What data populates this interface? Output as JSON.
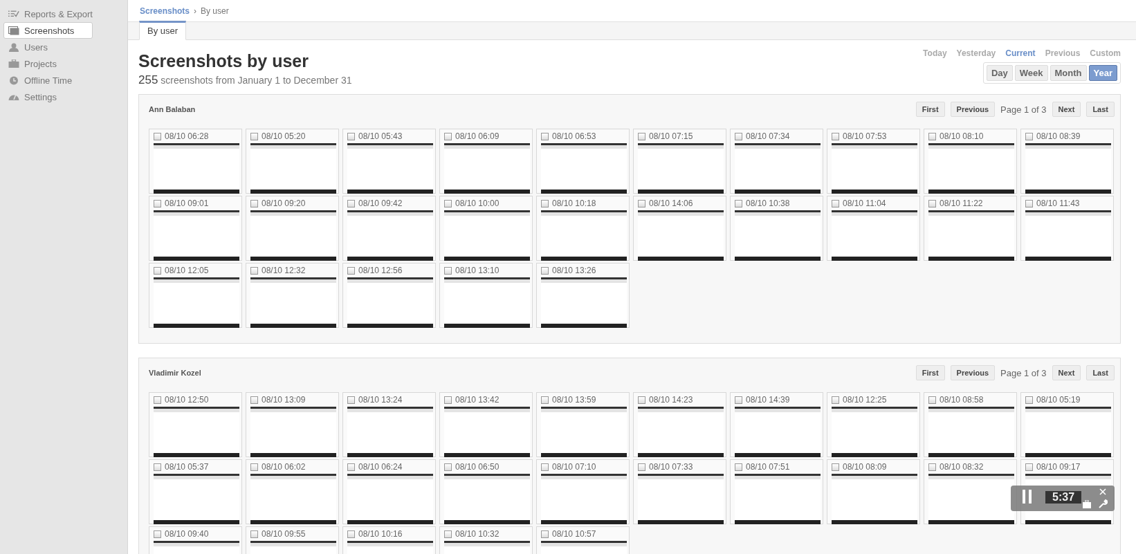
{
  "sidebar": {
    "items": [
      {
        "label": "Reports & Export",
        "selected": false
      },
      {
        "label": "Screenshots",
        "selected": true
      },
      {
        "label": "Users",
        "selected": false
      },
      {
        "label": "Projects",
        "selected": false
      },
      {
        "label": "Offline Time",
        "selected": false
      },
      {
        "label": "Settings",
        "selected": false
      }
    ]
  },
  "breadcrumb": {
    "parent": "Screenshots",
    "separator": "›",
    "current": "By user"
  },
  "tabs": [
    {
      "label": "By user",
      "selected": true
    }
  ],
  "title": "Screenshots by user",
  "summary": {
    "count": "255",
    "text": "screenshots from January 1 to December 31"
  },
  "range_links": [
    {
      "label": "Today",
      "selected": false
    },
    {
      "label": "Yesterday",
      "selected": false
    },
    {
      "label": "Current",
      "selected": true
    },
    {
      "label": "Previous",
      "selected": false
    },
    {
      "label": "Custom",
      "selected": false
    }
  ],
  "periods": [
    {
      "label": "Day",
      "selected": false
    },
    {
      "label": "Week",
      "selected": false
    },
    {
      "label": "Month",
      "selected": false
    },
    {
      "label": "Year",
      "selected": true
    }
  ],
  "users": [
    {
      "name": "Ann Balaban",
      "pager": {
        "first": "First",
        "previous": "Previous",
        "page": "Page 1 of 3",
        "next": "Next",
        "last": "Last"
      },
      "screenshots": [
        {
          "time": "08/10 06:28",
          "checked": false
        },
        {
          "time": "08/10 05:20",
          "checked": false
        },
        {
          "time": "08/10 05:43",
          "checked": false
        },
        {
          "time": "08/10 06:09",
          "checked": false
        },
        {
          "time": "08/10 06:53",
          "checked": false
        },
        {
          "time": "08/10 07:15",
          "checked": false
        },
        {
          "time": "08/10 07:34",
          "checked": false
        },
        {
          "time": "08/10 07:53",
          "checked": false
        },
        {
          "time": "08/10 08:10",
          "checked": false
        },
        {
          "time": "08/10 08:39",
          "checked": false
        },
        {
          "time": "08/10 09:01",
          "checked": false
        },
        {
          "time": "08/10 09:20",
          "checked": false
        },
        {
          "time": "08/10 09:42",
          "checked": false
        },
        {
          "time": "08/10 10:00",
          "checked": false
        },
        {
          "time": "08/10 10:18",
          "checked": false
        },
        {
          "time": "08/10 14:06",
          "checked": false
        },
        {
          "time": "08/10 10:38",
          "checked": false
        },
        {
          "time": "08/10 11:04",
          "checked": false
        },
        {
          "time": "08/10 11:22",
          "checked": false
        },
        {
          "time": "08/10 11:43",
          "checked": false
        },
        {
          "time": "08/10 12:05",
          "checked": false
        },
        {
          "time": "08/10 12:32",
          "checked": false
        },
        {
          "time": "08/10 12:56",
          "checked": false
        },
        {
          "time": "08/10 13:10",
          "checked": false
        },
        {
          "time": "08/10 13:26",
          "checked": false
        }
      ]
    },
    {
      "name": "Vladimir Kozel",
      "pager": {
        "first": "First",
        "previous": "Previous",
        "page": "Page 1 of 3",
        "next": "Next",
        "last": "Last"
      },
      "screenshots": [
        {
          "time": "08/10 12:50",
          "checked": false
        },
        {
          "time": "08/10 13:09",
          "checked": false
        },
        {
          "time": "08/10 13:24",
          "checked": false
        },
        {
          "time": "08/10 13:42",
          "checked": false
        },
        {
          "time": "08/10 13:59",
          "checked": false
        },
        {
          "time": "08/10 14:23",
          "checked": false
        },
        {
          "time": "08/10 14:39",
          "checked": false
        },
        {
          "time": "08/10 12:25",
          "checked": false
        },
        {
          "time": "08/10 08:58",
          "checked": false
        },
        {
          "time": "08/10 05:19",
          "checked": false
        },
        {
          "time": "08/10 05:37",
          "checked": false
        },
        {
          "time": "08/10 06:02",
          "checked": false
        },
        {
          "time": "08/10 06:24",
          "checked": false
        },
        {
          "time": "08/10 06:50",
          "checked": false
        },
        {
          "time": "08/10 07:10",
          "checked": false
        },
        {
          "time": "08/10 07:33",
          "checked": false
        },
        {
          "time": "08/10 07:51",
          "checked": false
        },
        {
          "time": "08/10 08:09",
          "checked": false
        },
        {
          "time": "08/10 08:32",
          "checked": false
        },
        {
          "time": "08/10 09:17",
          "checked": false
        },
        {
          "time": "08/10 09:40",
          "checked": false
        },
        {
          "time": "08/10 09:55",
          "checked": false
        },
        {
          "time": "08/10 10:16",
          "checked": false
        },
        {
          "time": "08/10 10:32",
          "checked": false
        },
        {
          "time": "08/10 10:57",
          "checked": false
        }
      ]
    }
  ],
  "timer_widget": {
    "time": "5:37"
  }
}
